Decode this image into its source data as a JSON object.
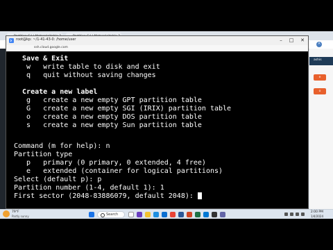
{
  "browser_tabs": [
    {
      "label": "Partition   C:\\ | Metasploitable 2"
    },
    {
      "label": "Partition   C:\\ | Metasploitable 2"
    }
  ],
  "ssh_window": {
    "title": "root@kp: ~/1-41-43-0: /home/user",
    "url": "ssh.cloud.google.com",
    "buttons": {
      "minimize": "–",
      "maximize": "□",
      "close": "✕"
    }
  },
  "terminal": {
    "lines": [
      {
        "text": "  Save & Exit",
        "bold": true
      },
      {
        "text": "   w   write table to disk and exit"
      },
      {
        "text": "   q   quit without saving changes"
      },
      {
        "text": ""
      },
      {
        "text": "  Create a new label",
        "bold": true
      },
      {
        "text": "   g   create a new empty GPT partition table"
      },
      {
        "text": "   G   create a new empty SGI (IRIX) partition table"
      },
      {
        "text": "   o   create a new empty DOS partition table"
      },
      {
        "text": "   s   create a new empty Sun partition table"
      },
      {
        "text": ""
      },
      {
        "text": ""
      },
      {
        "text": "Command (m for help): n"
      },
      {
        "text": "Partition type"
      },
      {
        "text": "   p   primary (0 primary, 0 extended, 4 free)"
      },
      {
        "text": "   e   extended (container for logical partitions)"
      },
      {
        "text": "Select (default p): p"
      },
      {
        "text": "Partition number (1-4, default 1): 1"
      },
      {
        "text": "First sector (2048-83886079, default 2048): "
      }
    ]
  },
  "right_panel": {
    "user": "ashis",
    "avatar": "A",
    "button_labels": [
      "e",
      "o"
    ]
  },
  "taskbar": {
    "weather_temp": "79°F",
    "weather_cond": "Partly sunny",
    "search_label": "Search",
    "time": "2:00 PM",
    "date": "1/4/2024"
  },
  "colors": {
    "terminal_bg": "#000000",
    "terminal_fg": "#ffffff",
    "taskbar_bg": "#dde5ef",
    "accent_orange": "#e8602c"
  }
}
